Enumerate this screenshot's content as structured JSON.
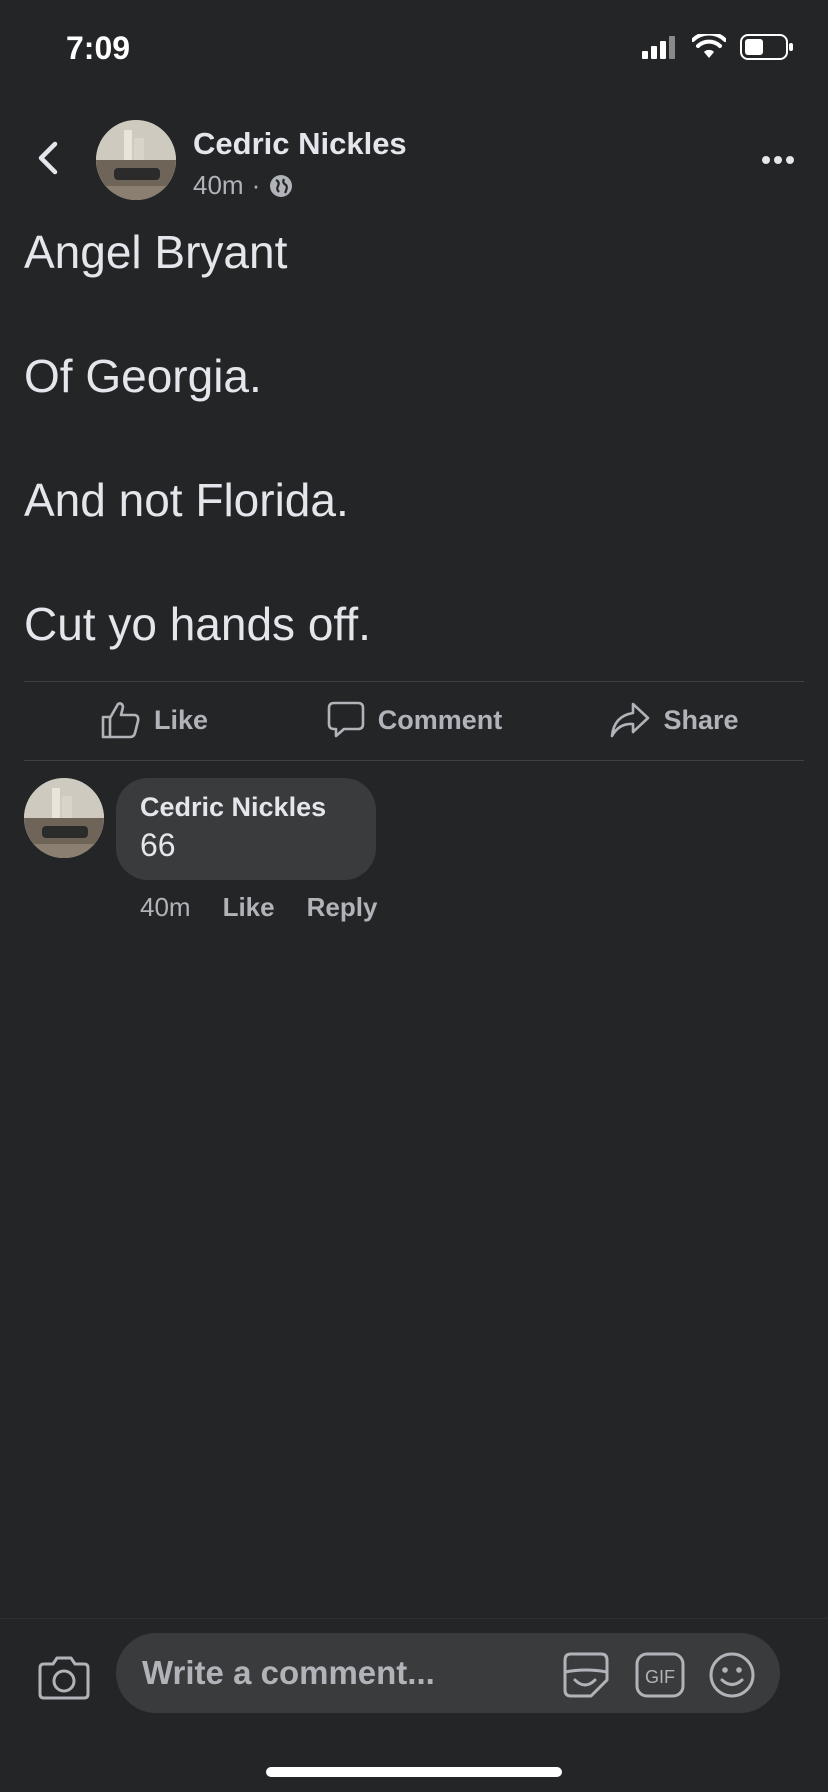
{
  "status": {
    "time": "7:09"
  },
  "post": {
    "author": "Cedric Nickles",
    "time": "40m",
    "separator": "·",
    "lines": [
      "Angel Bryant",
      "Of Georgia.",
      "And not Florida.",
      "Cut yo hands off."
    ]
  },
  "actions": {
    "like": "Like",
    "comment": "Comment",
    "share": "Share"
  },
  "comment": {
    "author": "Cedric Nickles",
    "text": "66",
    "time": "40m",
    "like": "Like",
    "reply": "Reply"
  },
  "composer": {
    "placeholder": "Write a comment..."
  },
  "icons": {
    "back": "chevron-left-icon",
    "more": "more-horizontal-icon",
    "privacy": "globe-icon",
    "like": "thumbs-up-icon",
    "comment": "speech-bubble-icon",
    "share": "share-arrow-icon",
    "camera": "camera-icon",
    "sticker": "sticker-icon",
    "gif": "gif-icon",
    "emoji": "smiley-icon"
  },
  "colors": {
    "background": "#242527",
    "bubble": "#3a3b3c",
    "text": "#e4e6eb",
    "secondary": "#b0b3b8"
  }
}
